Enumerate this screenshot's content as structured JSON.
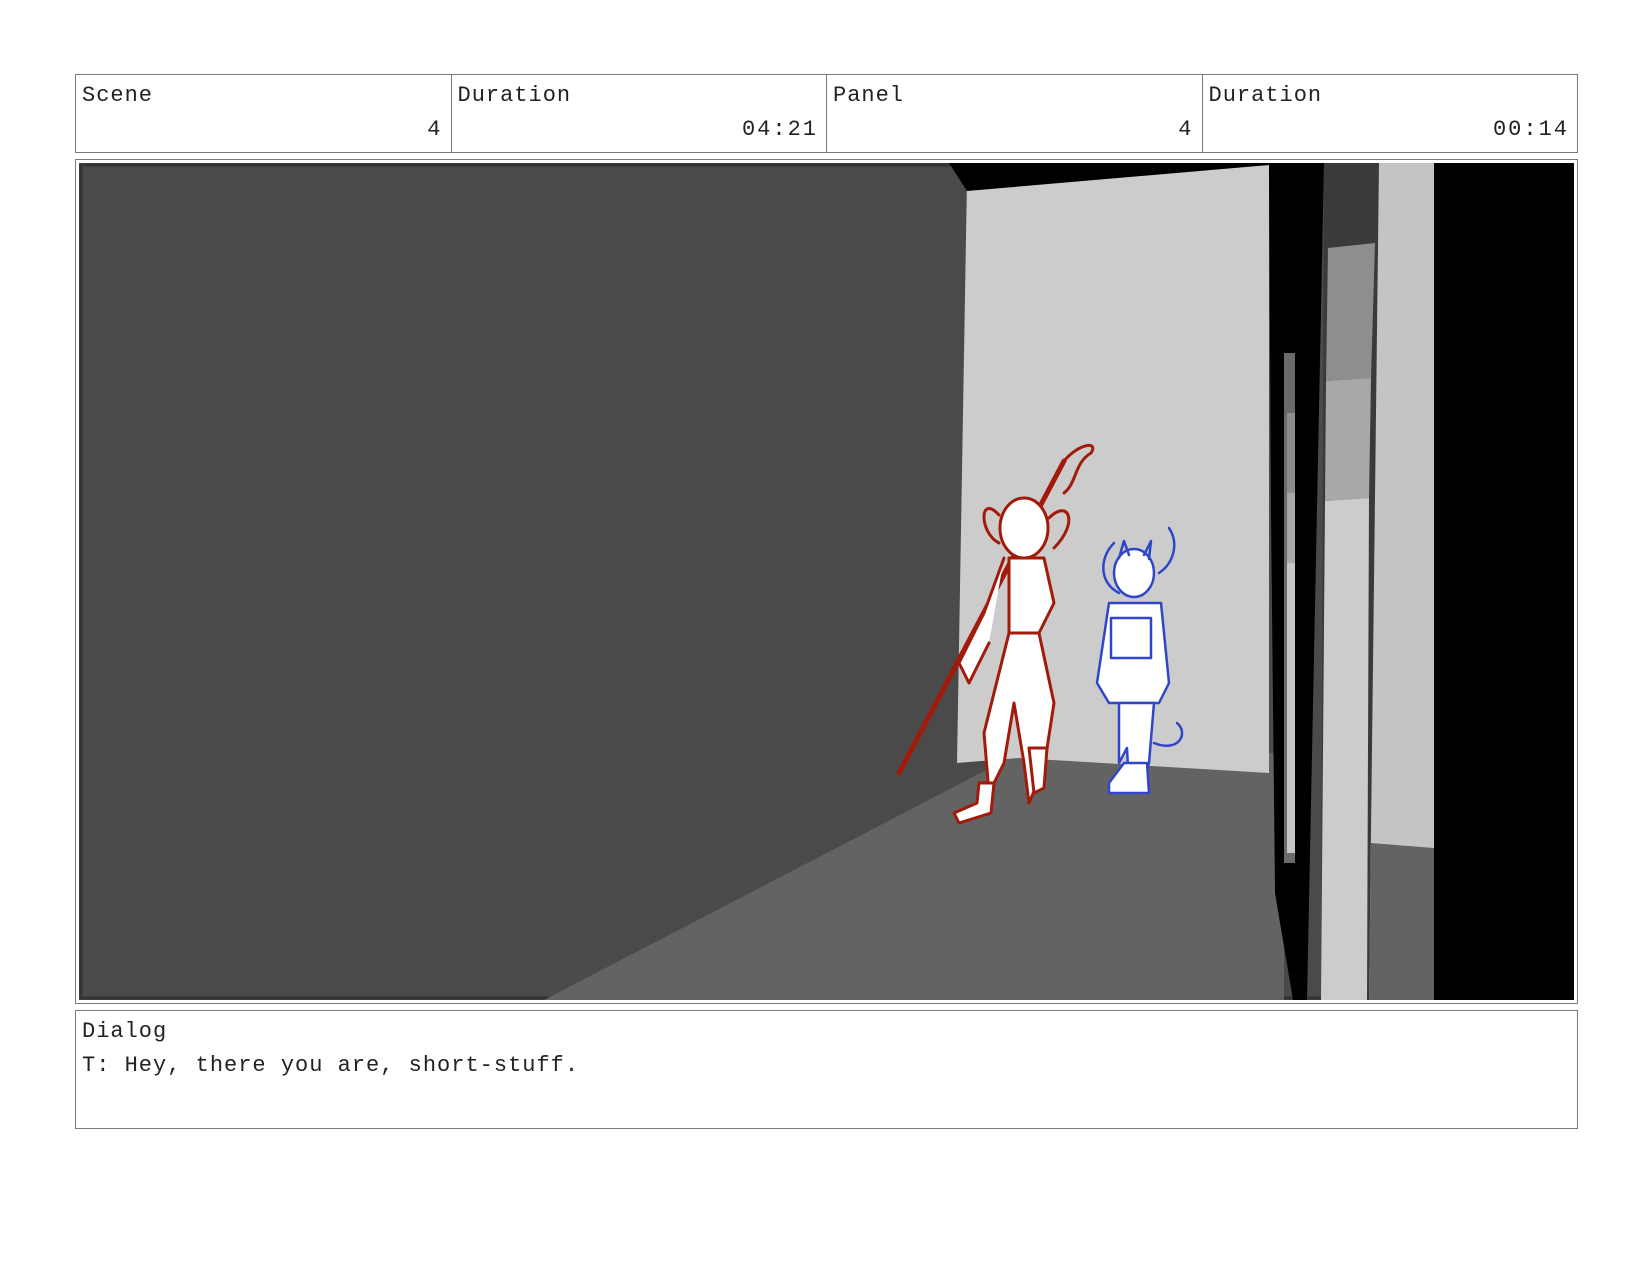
{
  "header": {
    "scene_label": "Scene",
    "scene_value": "4",
    "scene_duration_label": "Duration",
    "scene_duration_value": "04:21",
    "panel_label": "Panel",
    "panel_value": "4",
    "panel_duration_label": "Duration",
    "panel_duration_value": "00:14"
  },
  "panel": {
    "description": "",
    "colors": {
      "character_red": "#a11a0a",
      "character_blue": "#3046c8",
      "wall_dark": "#4a4a4a",
      "floor": "#636363",
      "back_wall": "#cccccc",
      "pillar": "#000000"
    }
  },
  "dialog": {
    "label": "Dialog",
    "text": "T: Hey, there you are, short-stuff."
  }
}
